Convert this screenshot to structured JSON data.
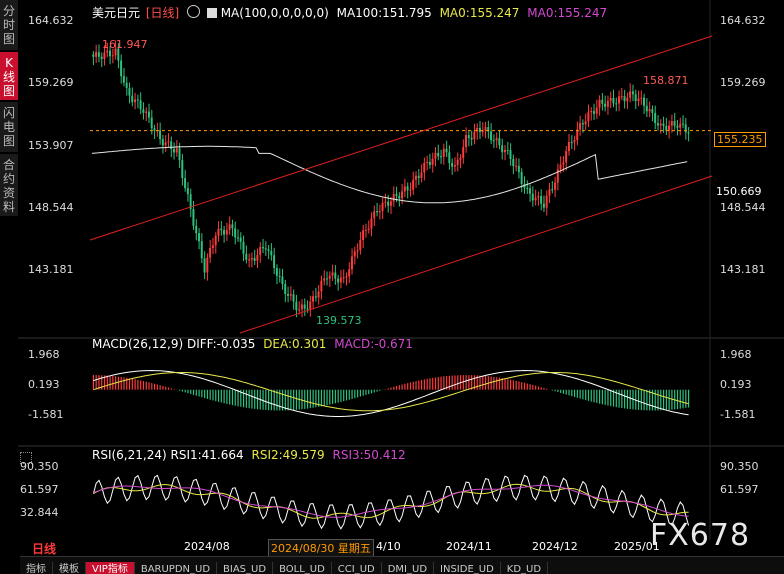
{
  "header": {
    "symbol": "美元日元",
    "period_tag": "[日线]",
    "ma_params": "MA(100,0,0,0,0,0)",
    "ma100": "MA100:151.795",
    "ma0_a": "MA0:155.247",
    "ma0_b": "MA0:155.247"
  },
  "side_tabs": [
    {
      "label": "分时图",
      "active": false
    },
    {
      "label": "K线图",
      "active": true
    },
    {
      "label": "闪电图",
      "active": false
    },
    {
      "label": "合约资料",
      "active": false
    }
  ],
  "price_panel": {
    "right_ticks": [
      "164.632",
      "159.269",
      "153.907",
      "148.544",
      "143.181"
    ],
    "left_ticks": [
      "164.632",
      "159.269",
      "153.907",
      "148.544",
      "143.181"
    ],
    "current_price": "155.235",
    "ma_value_label": "150.669",
    "annot_high_left": "161.947",
    "annot_high_right": "158.871",
    "annot_low": "139.573"
  },
  "macd_panel": {
    "title": "MACD(26,12,9)",
    "diff": "DIFF:-0.035",
    "dea": "DEA:0.301",
    "macd": "MACD:-0.671",
    "ticks": [
      "1.968",
      "0.193",
      "-1.581"
    ]
  },
  "rsi_panel": {
    "title": "RSI(6,21,24)",
    "rsi1": "RSI1:41.664",
    "rsi2": "RSI2:49.579",
    "rsi3": "RSI3:50.412",
    "ticks": [
      "90.350",
      "61.597",
      "32.844"
    ]
  },
  "x_axis": {
    "labels": [
      "2024/08",
      "4/10",
      "2024/11",
      "2024/12",
      "2025/01"
    ],
    "cursor_date": "2024/08/30 星期五"
  },
  "footer": {
    "period": "日线",
    "tabs": [
      "指标",
      "模板",
      "VIP指标",
      "BARUPDN_UD",
      "BIAS_UD",
      "BOLL_UD",
      "CCI_UD",
      "DMI_UD",
      "INSIDE_UD",
      "KD_UD"
    ]
  },
  "watermark": "FX678",
  "colors": {
    "up": "#ff3b3b",
    "down": "#2ec27e",
    "ma": "#e6e6e6",
    "channel": "#e02020",
    "diff": "#ffffff",
    "dea": "#e8e84a",
    "rsi1": "#ffffff",
    "rsi2": "#e8e84a",
    "rsi3": "#d04ad0",
    "price_line": "#ff9900"
  },
  "chart_data": [
    {
      "type": "candlestick",
      "title": "美元日元 日线",
      "ylim": [
        139.573,
        164.632
      ],
      "series": [
        {
          "name": "MA100",
          "values_start": 153.3,
          "values_end": 151.795
        },
        {
          "name": "MA0",
          "value": 155.247
        }
      ],
      "annotations": {
        "high_left": 161.947,
        "high_right": 158.871,
        "low": 139.573,
        "last": 155.235,
        "ma_label": 150.669
      }
    },
    {
      "type": "line",
      "title": "MACD(26,12,9)",
      "ylim": [
        -1.581,
        1.968
      ],
      "series": [
        {
          "name": "DIFF",
          "last": -0.035
        },
        {
          "name": "DEA",
          "last": 0.301
        },
        {
          "name": "MACD",
          "last": -0.671
        }
      ]
    },
    {
      "type": "line",
      "title": "RSI(6,21,24)",
      "ylim": [
        32.844,
        90.35
      ],
      "series": [
        {
          "name": "RSI1",
          "last": 41.664
        },
        {
          "name": "RSI2",
          "last": 49.579
        },
        {
          "name": "RSI3",
          "last": 50.412
        }
      ]
    }
  ]
}
